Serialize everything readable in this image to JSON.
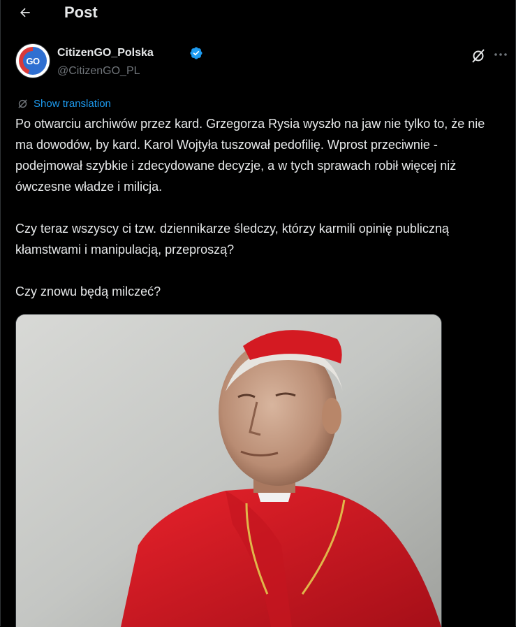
{
  "header": {
    "title": "Post"
  },
  "author": {
    "avatar_text": "GO",
    "display_name": "CitizenGO_Polska",
    "handle": "@CitizenGO_PL"
  },
  "translation": {
    "label": "Show translation"
  },
  "tweet": {
    "paragraphs": [
      "Po otwarciu archiwów przez kard. Grzegorza Rysia wyszło na jaw nie tylko to, że nie ma dowodów, by kard. Karol Wojtyła tuszował pedofilię. Wprost przeciwnie - podejmował szybkie i zdecydowane decyzje, a w tych sprawach robił więcej niż ówczesne władze i milicja.",
      "Czy teraz wszyscy ci tzw. dziennikarze śledczy, którzy  karmili opinię publiczną kłamstwami i manipulacją, przeproszą?",
      "Czy znowu będą milczeć?"
    ]
  },
  "colors": {
    "background": "#000000",
    "text": "#e7e9ea",
    "secondary_text": "#71767b",
    "accent": "#1d9bf0",
    "border": "#2f3336"
  },
  "icons": [
    "back-arrow-icon",
    "verified-badge-icon",
    "grok-icon",
    "more-icon",
    "translate-icon"
  ]
}
